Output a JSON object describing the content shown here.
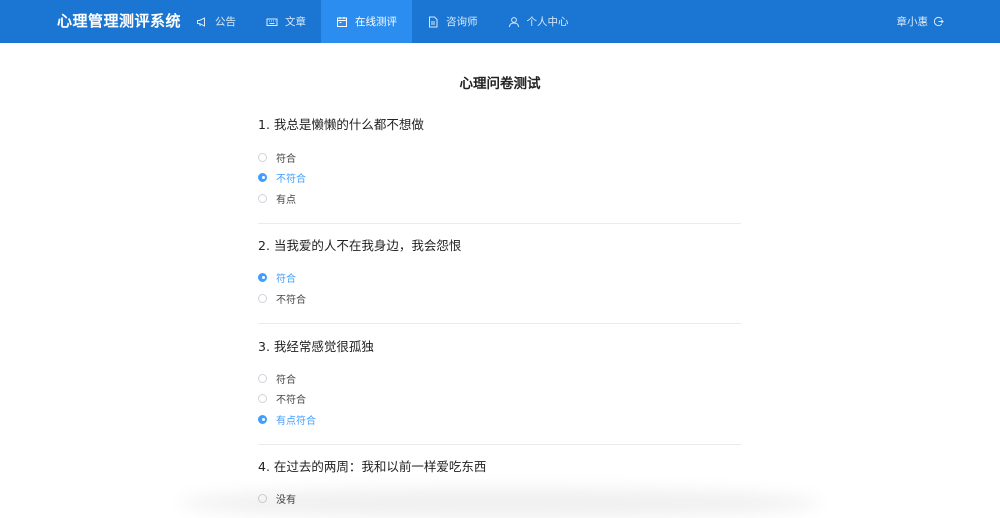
{
  "app": {
    "title": "心理管理测评系统"
  },
  "nav": [
    {
      "label": "公告",
      "icon": "megaphone-icon",
      "active": false
    },
    {
      "label": "文章",
      "icon": "keyboard-icon",
      "active": false
    },
    {
      "label": "在线测评",
      "icon": "calendar-icon",
      "active": true
    },
    {
      "label": "咨询师",
      "icon": "document-icon",
      "active": false
    },
    {
      "label": "个人中心",
      "icon": "user-icon",
      "active": false
    }
  ],
  "user": {
    "name": "章小惠",
    "logout_icon": "logout-icon"
  },
  "page": {
    "title": "心理问卷测试"
  },
  "questions": [
    {
      "title": "1. 我总是懒懒的什么都不想做",
      "options": [
        "符合",
        "不符合",
        "有点"
      ],
      "selected": 1
    },
    {
      "title": "2. 当我爱的人不在我身边，我会怨恨",
      "options": [
        "符合",
        "不符合"
      ],
      "selected": 0
    },
    {
      "title": "3. 我经常感觉很孤独",
      "options": [
        "符合",
        "不符合",
        "有点符合"
      ],
      "selected": 2
    },
    {
      "title": "4. 在过去的两周：我和以前一样爱吃东西",
      "options": [
        "没有"
      ],
      "selected": -1
    }
  ],
  "colors": {
    "header": "#1a76d2",
    "active_tab": "#2b8df0",
    "accent": "#409eff"
  }
}
